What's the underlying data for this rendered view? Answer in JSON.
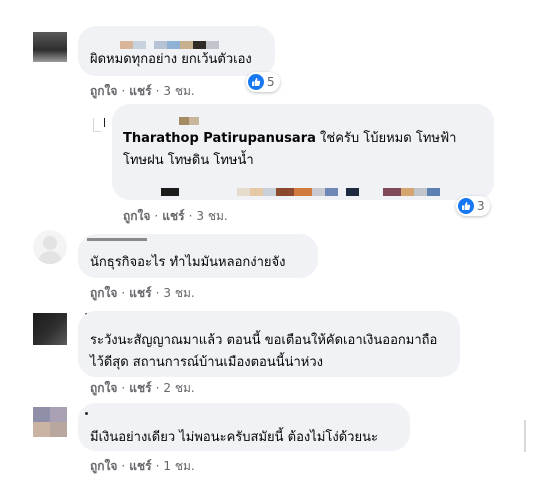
{
  "comments": [
    {
      "text": "ผิดหมดทุกอย่าง ยกเว้นตัวเอง",
      "actions": {
        "like": "ถูกใจ",
        "reply": "แชร์",
        "time": "3 ชม."
      },
      "reaction": {
        "icon": "like-icon",
        "count": "5"
      }
    },
    {
      "author": "Tharathop Patirupanusara",
      "text_line1": "ใช่ครับ โบ้ยหมด โทษฟ้า",
      "text_line2": "โทษฝน โทษดิน โทษน้ำ",
      "actions": {
        "like": "ถูกใจ",
        "reply": "แชร์",
        "time": "3 ชม."
      },
      "reaction": {
        "icon": "like-icon",
        "count": "3"
      }
    },
    {
      "text": "นักธุรกิจอะไร ทำไมมันหลอกง่ายจัง",
      "actions": {
        "like": "ถูกใจ",
        "reply": "แชร์",
        "time": "3 ชม."
      }
    },
    {
      "text_line1": "ระวังนะสัญญาณมาแล้ว ตอนนี้ ขอเตือนให้คัดเอาเงินออกมาถือ",
      "text_line2": "ไว้ดีสุด สถานการณ์บ้านเมืองตอนนี้น่าห่วง",
      "actions": {
        "like": "ถูกใจ",
        "reply": "แชร์",
        "time": "2 ชม."
      }
    },
    {
      "text": "มีเงินอย่างเดียว ไม่พอนะครับสมัยนี้ ต้องไม่โง่ด้วยนะ",
      "actions": {
        "like": "ถูกใจ",
        "reply": "แชร์",
        "time": "1 ชม."
      }
    }
  ],
  "colors": {
    "bubble": "#f0f2f5",
    "meta_text": "#65676b",
    "like_blue": "#1877f2"
  }
}
